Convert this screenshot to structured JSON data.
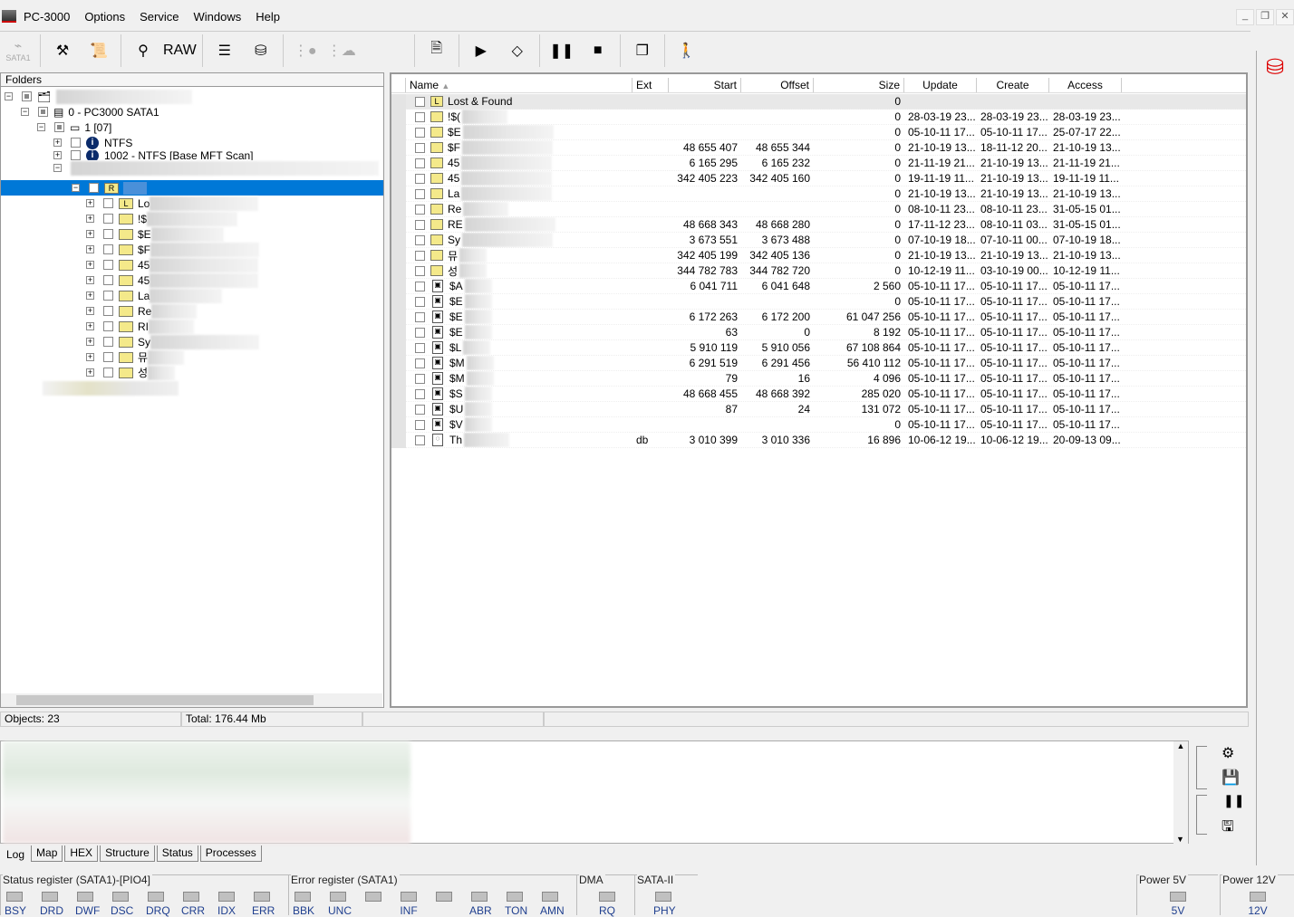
{
  "menu": {
    "app": "PC-3000",
    "items": [
      "Options",
      "Service",
      "Windows",
      "Help"
    ]
  },
  "window_buttons": [
    "_",
    "❐",
    "✕"
  ],
  "toolbar": {
    "sata_label": "SATA1",
    "raw_label": "RAW",
    "tools": [
      "tools-icon",
      "info-scroll-icon",
      "binoculars-icon",
      "raw",
      "filter-stack-icon",
      "db-filter-icon",
      "tree-disabled-icon",
      "tree-cloud-disabled-icon",
      "doc-check-icon",
      "play-icon",
      "decision-flow-icon",
      "pause-icon",
      "stop-icon",
      "windows-icon",
      "exit-icon"
    ]
  },
  "tree": {
    "header": "Folders",
    "root": "",
    "device": "0 - PC3000 SATA1",
    "partition": "1 [07]",
    "fs1": "NTFS",
    "fs2": "1002 - NTFS [Base MFT Scan]",
    "selected_label": "R",
    "children": [
      {
        "p": "Lo",
        "i": "L"
      },
      {
        "p": "!$"
      },
      {
        "p": "$E"
      },
      {
        "p": "$F"
      },
      {
        "p": "45"
      },
      {
        "p": "45"
      },
      {
        "p": "La"
      },
      {
        "p": "Re"
      },
      {
        "p": "RI"
      },
      {
        "p": "Sy"
      },
      {
        "p": "뮤"
      },
      {
        "p": "성"
      }
    ]
  },
  "table": {
    "columns": {
      "name": "Name",
      "ext": "Ext",
      "start": "Start",
      "offset": "Offset",
      "size": "Size",
      "update": "Update",
      "create": "Create",
      "access": "Access"
    },
    "rows": [
      {
        "t": "L",
        "n": "Lost & Found",
        "e": "",
        "s": "",
        "o": "",
        "z": "0",
        "u": "",
        "c": "",
        "a": ""
      },
      {
        "t": "d",
        "n": "!$(",
        "e": "",
        "s": "",
        "o": "",
        "z": "0",
        "u": "28-03-19 23...",
        "c": "28-03-19 23...",
        "a": "28-03-19 23..."
      },
      {
        "t": "d",
        "n": "$E",
        "e": "",
        "s": "",
        "o": "",
        "z": "0",
        "u": "05-10-11 17...",
        "c": "05-10-11 17...",
        "a": "25-07-17 22..."
      },
      {
        "t": "d",
        "n": "$F",
        "e": "",
        "s": "48 655 407",
        "o": "48 655 344",
        "z": "0",
        "u": "21-10-19 13...",
        "c": "18-11-12 20...",
        "a": "21-10-19 13..."
      },
      {
        "t": "d",
        "n": "45",
        "e": "",
        "s": "6 165 295",
        "o": "6 165 232",
        "z": "0",
        "u": "21-11-19 21...",
        "c": "21-10-19 13...",
        "a": "21-11-19 21..."
      },
      {
        "t": "d",
        "n": "45",
        "e": "",
        "s": "342 405 223",
        "o": "342 405 160",
        "z": "0",
        "u": "19-11-19 11...",
        "c": "21-10-19 13...",
        "a": "19-11-19 11..."
      },
      {
        "t": "d",
        "n": "La",
        "e": "",
        "s": "",
        "o": "",
        "z": "0",
        "u": "21-10-19 13...",
        "c": "21-10-19 13...",
        "a": "21-10-19 13..."
      },
      {
        "t": "d",
        "n": "Re",
        "e": "",
        "s": "",
        "o": "",
        "z": "0",
        "u": "08-10-11 23...",
        "c": "08-10-11 23...",
        "a": "31-05-15 01..."
      },
      {
        "t": "d",
        "n": "RE",
        "e": "",
        "s": "48 668 343",
        "o": "48 668 280",
        "z": "0",
        "u": "17-11-12 23...",
        "c": "08-10-11 03...",
        "a": "31-05-15 01..."
      },
      {
        "t": "d",
        "n": "Sy",
        "e": "",
        "s": "3 673 551",
        "o": "3 673 488",
        "z": "0",
        "u": "07-10-19 18...",
        "c": "07-10-11 00...",
        "a": "07-10-19 18..."
      },
      {
        "t": "d",
        "n": "뮤",
        "e": "",
        "s": "342 405 199",
        "o": "342 405 136",
        "z": "0",
        "u": "21-10-19 13...",
        "c": "21-10-19 13...",
        "a": "21-10-19 13..."
      },
      {
        "t": "d",
        "n": "성",
        "e": "",
        "s": "344 782 783",
        "o": "344 782 720",
        "z": "0",
        "u": "10-12-19 11...",
        "c": "03-10-19 00...",
        "a": "10-12-19 11..."
      },
      {
        "t": "f",
        "n": "$A",
        "e": "",
        "s": "6 041 711",
        "o": "6 041 648",
        "z": "2 560",
        "u": "05-10-11 17...",
        "c": "05-10-11 17...",
        "a": "05-10-11 17..."
      },
      {
        "t": "f",
        "n": "$E",
        "e": "",
        "s": "",
        "o": "",
        "z": "0",
        "u": "05-10-11 17...",
        "c": "05-10-11 17...",
        "a": "05-10-11 17..."
      },
      {
        "t": "f",
        "n": "$E",
        "e": "",
        "s": "6 172 263",
        "o": "6 172 200",
        "z": "61 047 256",
        "u": "05-10-11 17...",
        "c": "05-10-11 17...",
        "a": "05-10-11 17..."
      },
      {
        "t": "f",
        "n": "$E",
        "e": "",
        "s": "63",
        "o": "0",
        "z": "8 192",
        "u": "05-10-11 17...",
        "c": "05-10-11 17...",
        "a": "05-10-11 17..."
      },
      {
        "t": "f",
        "n": "$L",
        "e": "",
        "s": "5 910 119",
        "o": "5 910 056",
        "z": "67 108 864",
        "u": "05-10-11 17...",
        "c": "05-10-11 17...",
        "a": "05-10-11 17..."
      },
      {
        "t": "f",
        "n": "$M",
        "e": "",
        "s": "6 291 519",
        "o": "6 291 456",
        "z": "56 410 112",
        "u": "05-10-11 17...",
        "c": "05-10-11 17...",
        "a": "05-10-11 17..."
      },
      {
        "t": "f",
        "n": "$M",
        "e": "",
        "s": "79",
        "o": "16",
        "z": "4 096",
        "u": "05-10-11 17...",
        "c": "05-10-11 17...",
        "a": "05-10-11 17..."
      },
      {
        "t": "f",
        "n": "$S",
        "e": "",
        "s": "48 668 455",
        "o": "48 668 392",
        "z": "285 020",
        "u": "05-10-11 17...",
        "c": "05-10-11 17...",
        "a": "05-10-11 17..."
      },
      {
        "t": "f",
        "n": "$U",
        "e": "",
        "s": "87",
        "o": "24",
        "z": "131 072",
        "u": "05-10-11 17...",
        "c": "05-10-11 17...",
        "a": "05-10-11 17..."
      },
      {
        "t": "f",
        "n": "$V",
        "e": "",
        "s": "",
        "o": "",
        "z": "0",
        "u": "05-10-11 17...",
        "c": "05-10-11 17...",
        "a": "05-10-11 17..."
      },
      {
        "t": "g",
        "n": "Th",
        "e": "db",
        "s": "3 010 399",
        "o": "3 010 336",
        "z": "16 896",
        "u": "10-06-12 19...",
        "c": "10-06-12 19...",
        "a": "20-09-13 09..."
      }
    ]
  },
  "status": {
    "objects": "Objects: 23",
    "total": "Total: 176.44 Mb"
  },
  "tabs": [
    "Log",
    "Map",
    "HEX",
    "Structure",
    "Status",
    "Processes"
  ],
  "registers": [
    {
      "title": "Status register (SATA1)-[PIO4]",
      "leds": [
        "BSY",
        "DRD",
        "DWF",
        "DSC",
        "DRQ",
        "CRR",
        "IDX",
        "ERR"
      ]
    },
    {
      "title": "Error register (SATA1)",
      "leds": [
        "BBK",
        "UNC",
        "",
        "INF",
        "",
        "ABR",
        "TON",
        "AMN"
      ]
    },
    {
      "title": "DMA",
      "leds": [
        "RQ"
      ]
    },
    {
      "title": "SATA-II",
      "leds": [
        "PHY"
      ]
    },
    {
      "title": "Power 5V",
      "leds": [
        "5V"
      ]
    },
    {
      "title": "Power 12V",
      "leds": [
        "12V"
      ]
    }
  ],
  "colors": {
    "selection": "#0078d7",
    "folder": "#f4e98a",
    "led_off": "#c0c0c0",
    "led_label": "#1f3f8f"
  }
}
